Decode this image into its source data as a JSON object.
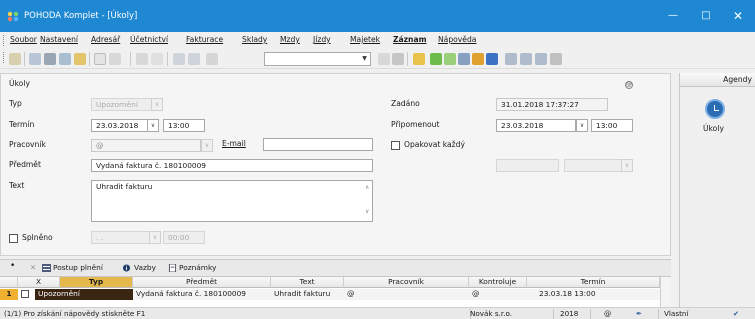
{
  "window": {
    "title": "POHODA Komplet - [Úkoly]"
  },
  "menu": [
    "Soubor",
    "Nastavení",
    "Adresář",
    "Účetnictví",
    "Fakturace",
    "Sklady",
    "Mzdy",
    "Jízdy",
    "Majetek",
    "Záznam",
    "Nápověda"
  ],
  "form": {
    "section_title": "Úkoly",
    "typ_label": "Typ",
    "typ_value": "Upozornění",
    "termin_label": "Termín",
    "termin_date": "23.03.2018",
    "termin_time": "13:00",
    "pracovnik_label": "Pracovník",
    "pracovnik_value": "@",
    "email_label": "E-mail",
    "email_value": "",
    "predmet_label": "Předmět",
    "predmet_value": "Vydaná faktura č. 180100009",
    "text_label": "Text",
    "text_value": "Uhradit fakturu",
    "splneno_label": "Splněno",
    "splneno_date": ". .",
    "splneno_time": "00:00",
    "zadano_label": "Zadáno",
    "zadano_value": "31.01.2018 17:37:27",
    "pripomenout_label": "Připomenout",
    "pripomenout_date": "23.03.2018",
    "pripomenout_time": "13:00",
    "opakovat_label": "Opakovat každý",
    "at_symbol": "@"
  },
  "agenda": {
    "header": "Agendy",
    "item": "Úkoly"
  },
  "subtabs": [
    "Postup plnění",
    "Vazby",
    "Poznámky"
  ],
  "grid": {
    "columns": [
      "X",
      "Typ",
      "Předmět",
      "Text",
      "Pracovník",
      "Kontroluje",
      "Termín"
    ],
    "rows": [
      {
        "num": "1",
        "typ": "Upozornění",
        "predmet": "Vydaná faktura č. 180100009",
        "text": "Uhradit fakturu",
        "pracovnik": "@",
        "kontroluje": "@",
        "termin": "23.03.18 13:00"
      }
    ]
  },
  "statusbar": {
    "hint": "(1/1) Pro získání nápovědy stiskněte F1",
    "company": "Novák s.r.o.",
    "year": "2018",
    "at": "@",
    "user": "Vlastní"
  }
}
